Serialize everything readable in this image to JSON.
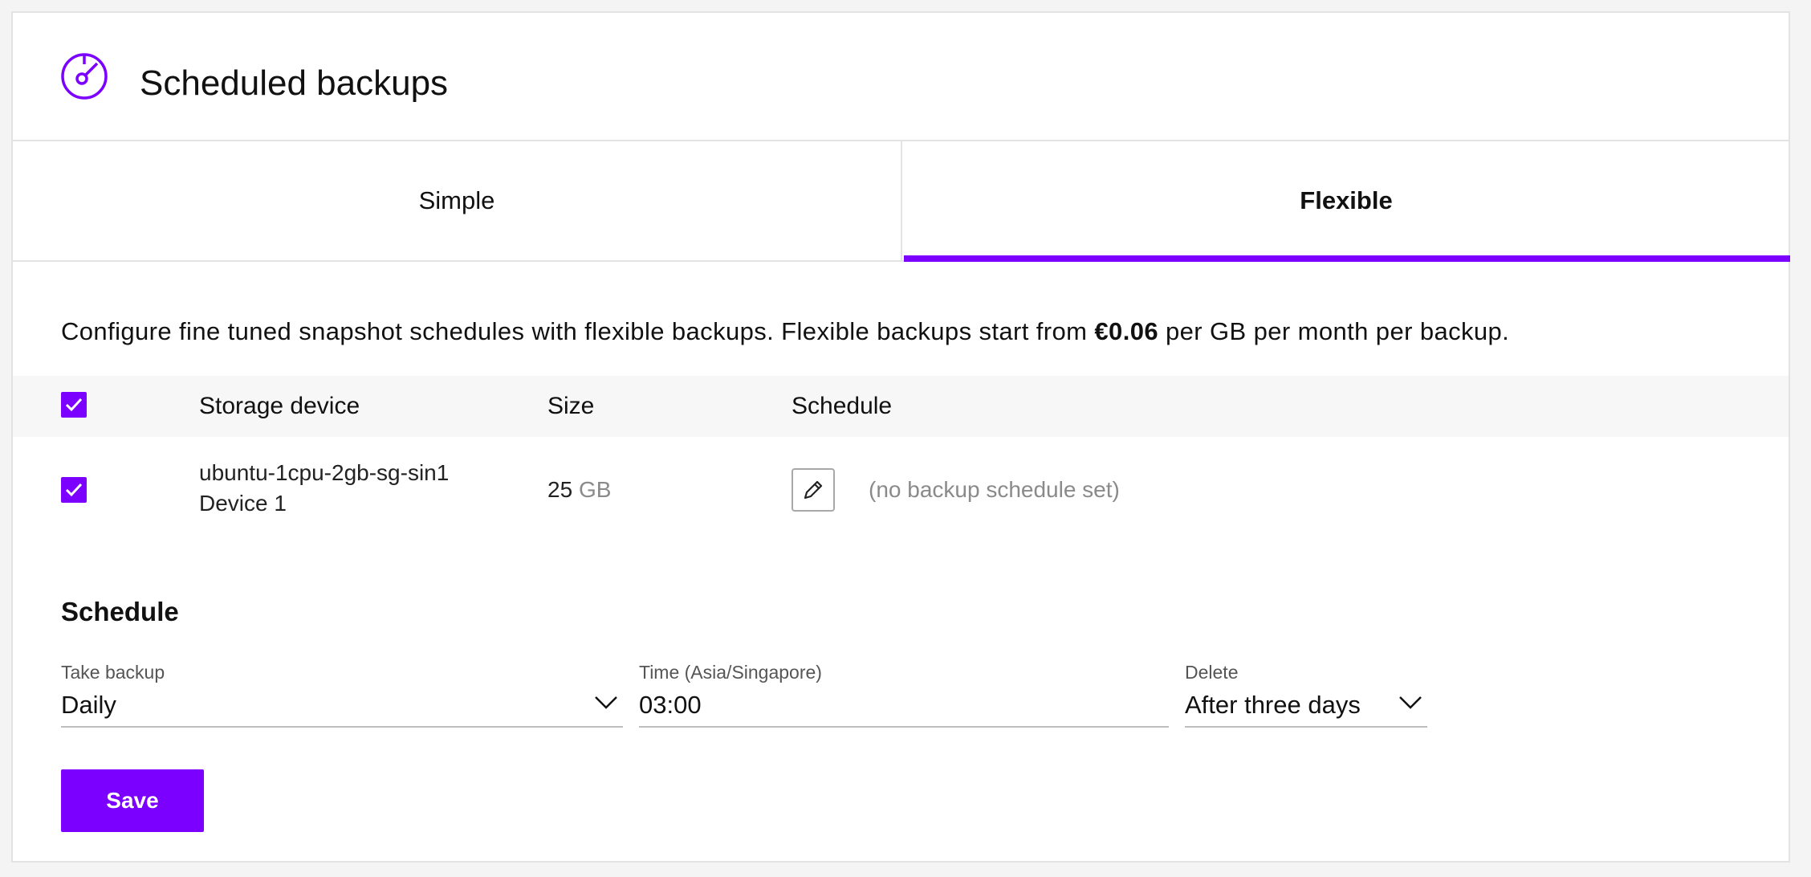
{
  "header": {
    "title": "Scheduled backups",
    "icon": "backup-disc-icon"
  },
  "tabs": [
    {
      "label": "Simple",
      "active": false
    },
    {
      "label": "Flexible",
      "active": true
    }
  ],
  "accent_color": "#7b00ff",
  "description": {
    "prefix": "Configure fine tuned snapshot schedules with flexible backups. Flexible backups start from ",
    "price": "€0.06",
    "suffix": " per GB per month per backup."
  },
  "table": {
    "headers": {
      "device": "Storage device",
      "size": "Size",
      "schedule": "Schedule"
    },
    "select_all_checked": true,
    "rows": [
      {
        "checked": true,
        "device": "ubuntu-1cpu-2gb-sg-sin1 Device 1",
        "size_value": "25",
        "size_unit": "GB",
        "schedule": "(no backup schedule set)"
      }
    ]
  },
  "schedule": {
    "title": "Schedule",
    "take_backup": {
      "label": "Take backup",
      "value": "Daily"
    },
    "time": {
      "label": "Time (Asia/Singapore)",
      "value": "03:00"
    },
    "delete": {
      "label": "Delete",
      "value": "After three days"
    }
  },
  "save_label": "Save"
}
